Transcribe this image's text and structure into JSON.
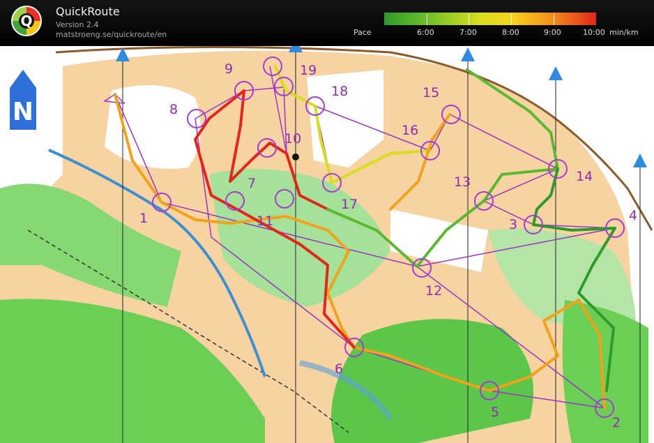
{
  "app": {
    "title": "QuickRoute",
    "version": "Version 2.4",
    "url": "matstroeng.se/quickroute/en",
    "logo_letter": "Q"
  },
  "pace_scale": {
    "label": "Pace",
    "ticks": [
      "6:00",
      "7:00",
      "8:00",
      "9:00",
      "10:00"
    ],
    "unit": "min/km",
    "colors": [
      "#2e9a2a",
      "#6cbf2a",
      "#d6de1d",
      "#f7d51c",
      "#f28a1a",
      "#e2261c"
    ]
  },
  "map": {
    "north_symbol": "N",
    "controls": [
      {
        "label": "1"
      },
      {
        "label": "2"
      },
      {
        "label": "3"
      },
      {
        "label": "4"
      },
      {
        "label": "5"
      },
      {
        "label": "6"
      },
      {
        "label": "7"
      },
      {
        "label": "8"
      },
      {
        "label": "9"
      },
      {
        "label": "10"
      },
      {
        "label": "11"
      },
      {
        "label": "12"
      },
      {
        "label": "13"
      },
      {
        "label": "14"
      },
      {
        "label": "15"
      },
      {
        "label": "16"
      },
      {
        "label": "17"
      },
      {
        "label": "18"
      },
      {
        "label": "19"
      }
    ]
  }
}
